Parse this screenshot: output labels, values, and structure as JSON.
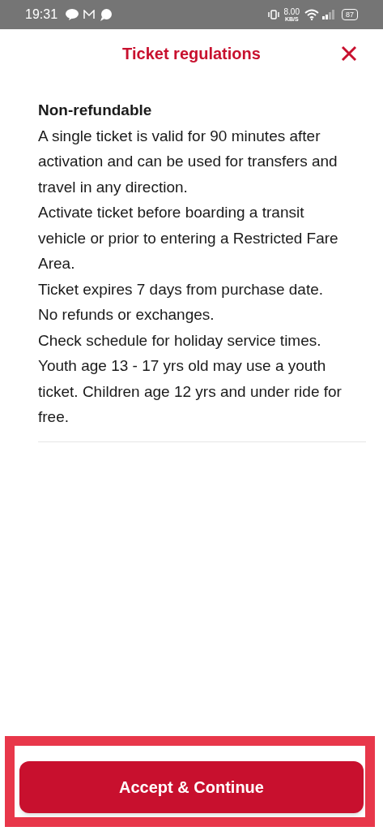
{
  "status_bar": {
    "time": "19:31",
    "speed_value": "8.00",
    "speed_unit": "KB/S",
    "battery": "87"
  },
  "header": {
    "title": "Ticket regulations"
  },
  "section": {
    "heading": "Non-refundable",
    "paragraphs": [
      "A single ticket is valid for 90 minutes after activation and can be used for transfers and travel in any direction.",
      "Activate ticket before boarding a transit vehicle or prior to entering a Restricted Fare Area.",
      "Ticket expires 7 days from purchase date.",
      "No refunds or exchanges.",
      "Check schedule for holiday service times.",
      "Youth age 13 - 17 yrs old may use a youth ticket. Children age 12 yrs and under ride for free."
    ]
  },
  "footer": {
    "button": "Accept & Continue",
    "highlighted": true
  }
}
